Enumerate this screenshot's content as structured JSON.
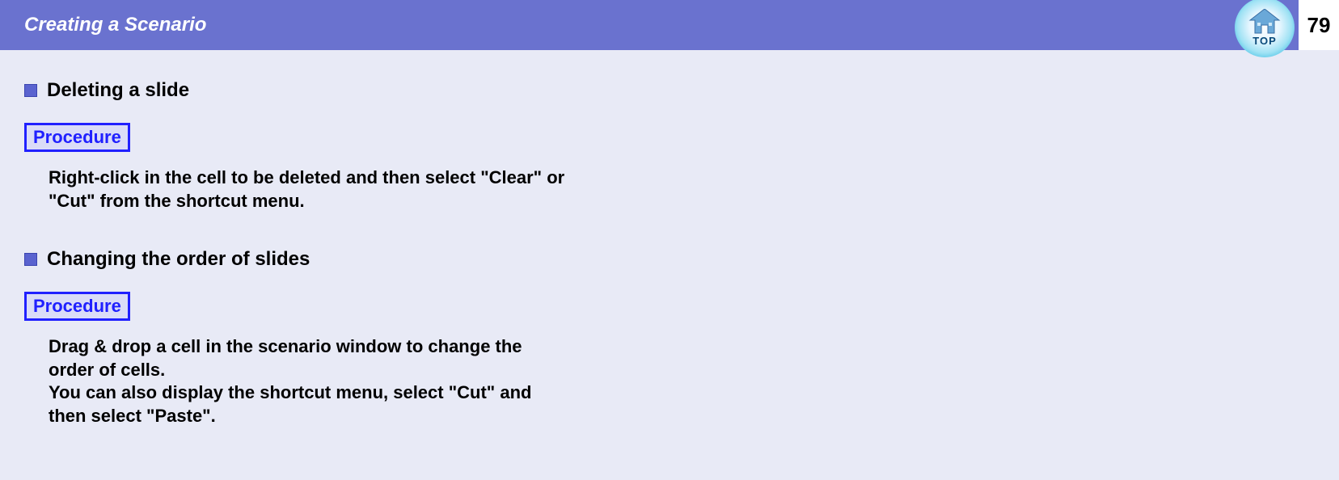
{
  "header": {
    "title": "Creating a Scenario",
    "top_button_label": "TOP",
    "page_number": "79"
  },
  "sections": [
    {
      "heading": "Deleting a slide",
      "procedure_label": "Procedure",
      "body": "Right-click in the cell to be deleted and then select \"Clear\" or \"Cut\" from the shortcut menu."
    },
    {
      "heading": "Changing the order of slides",
      "procedure_label": "Procedure",
      "body": "Drag & drop a cell in the scenario window to change the order of cells.\nYou can also display the shortcut menu, select \"Cut\" and then select \"Paste\"."
    }
  ]
}
